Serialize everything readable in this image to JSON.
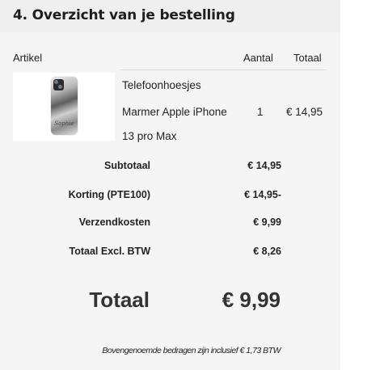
{
  "section": {
    "title": "4. Overzicht van je bestelling"
  },
  "table": {
    "headers": {
      "article": "Artikel",
      "quantity": "Aantal",
      "total": "Totaal"
    },
    "items": [
      {
        "name_lines": [
          "Telefoonhoesjes",
          "Marmer Apple iPhone",
          "13 pro Max"
        ],
        "quantity": "1",
        "price": "€ 14,95",
        "image_signature": "Sophie"
      }
    ]
  },
  "summary": [
    {
      "label": "Subtotaal",
      "value": "€ 14,95"
    },
    {
      "label": "Korting (PTE100)",
      "value": "€ 14,95-"
    },
    {
      "label": "Verzendkosten",
      "value": "€ 9,99"
    },
    {
      "label": "Totaal Excl. BTW",
      "value": "€ 8,26"
    }
  ],
  "total": {
    "label": "Totaal",
    "value": "€ 9,99"
  },
  "footnote": "Bovengenoemde bedragen zijn inclusief € 1,73 BTW"
}
